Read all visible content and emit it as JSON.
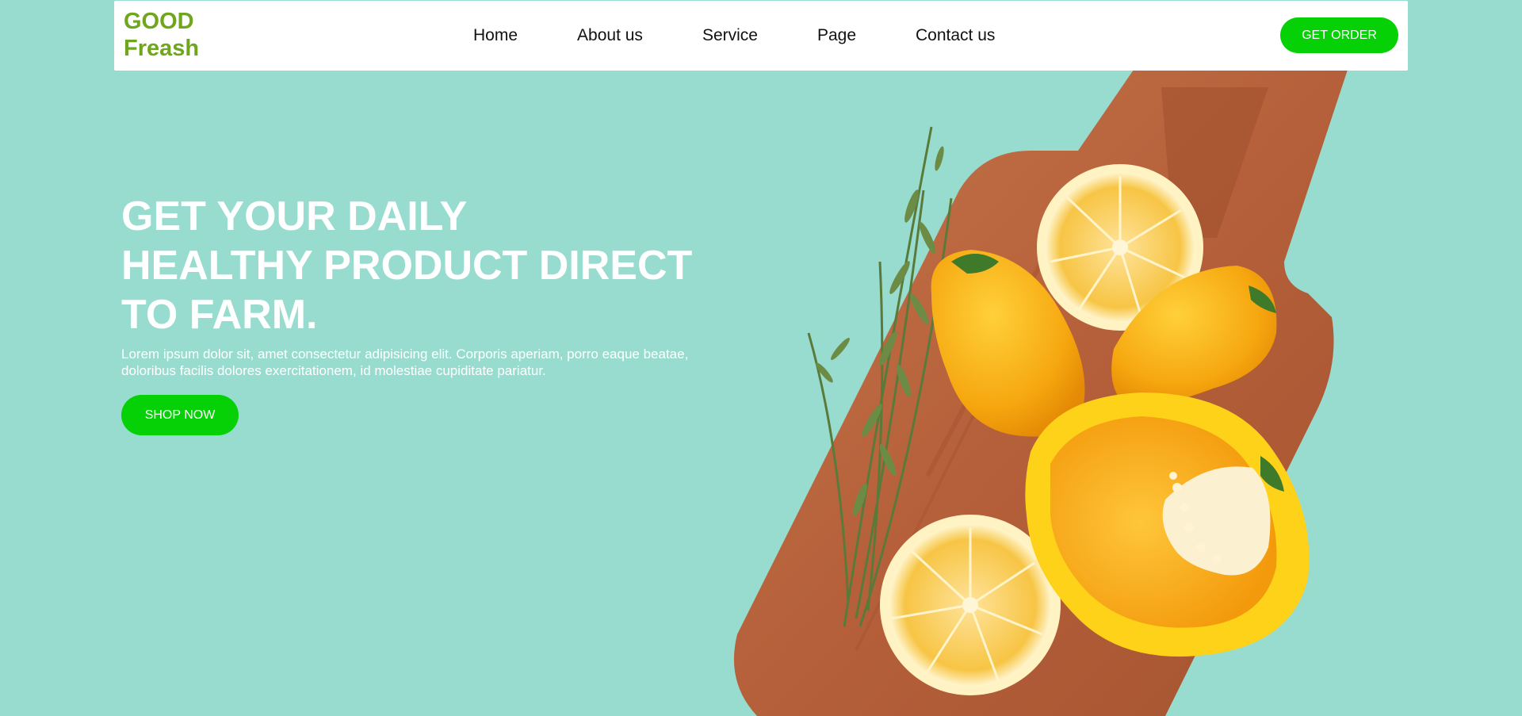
{
  "brand": {
    "line1": "GOOD",
    "line2": "Freash"
  },
  "nav": {
    "items": [
      {
        "label": "Home"
      },
      {
        "label": "About us"
      },
      {
        "label": "Service"
      },
      {
        "label": "Page"
      },
      {
        "label": "Contact us"
      }
    ],
    "cta_label": "GET ORDER"
  },
  "hero": {
    "headline_lines": [
      "GET YOUR DAILY",
      "HEALTHY PRODUCT DIRECT",
      "TO FARM."
    ],
    "body_lines": [
      "Lorem ipsum dolor sit, amet consectetur adipisicing elit. Corporis aperiam, porro eaque beatae,",
      "doloribus facilis dolores exercitationem, id molestiae cupiditate pariatur."
    ],
    "cta_label": "SHOP NOW",
    "image_subject": "cutting board with yellow peppers, lemon halves and rosemary"
  },
  "colors": {
    "background": "#97dccf",
    "accent_green": "#06d006",
    "logo_green": "#6fa61d",
    "nav_background": "#ffffff"
  }
}
